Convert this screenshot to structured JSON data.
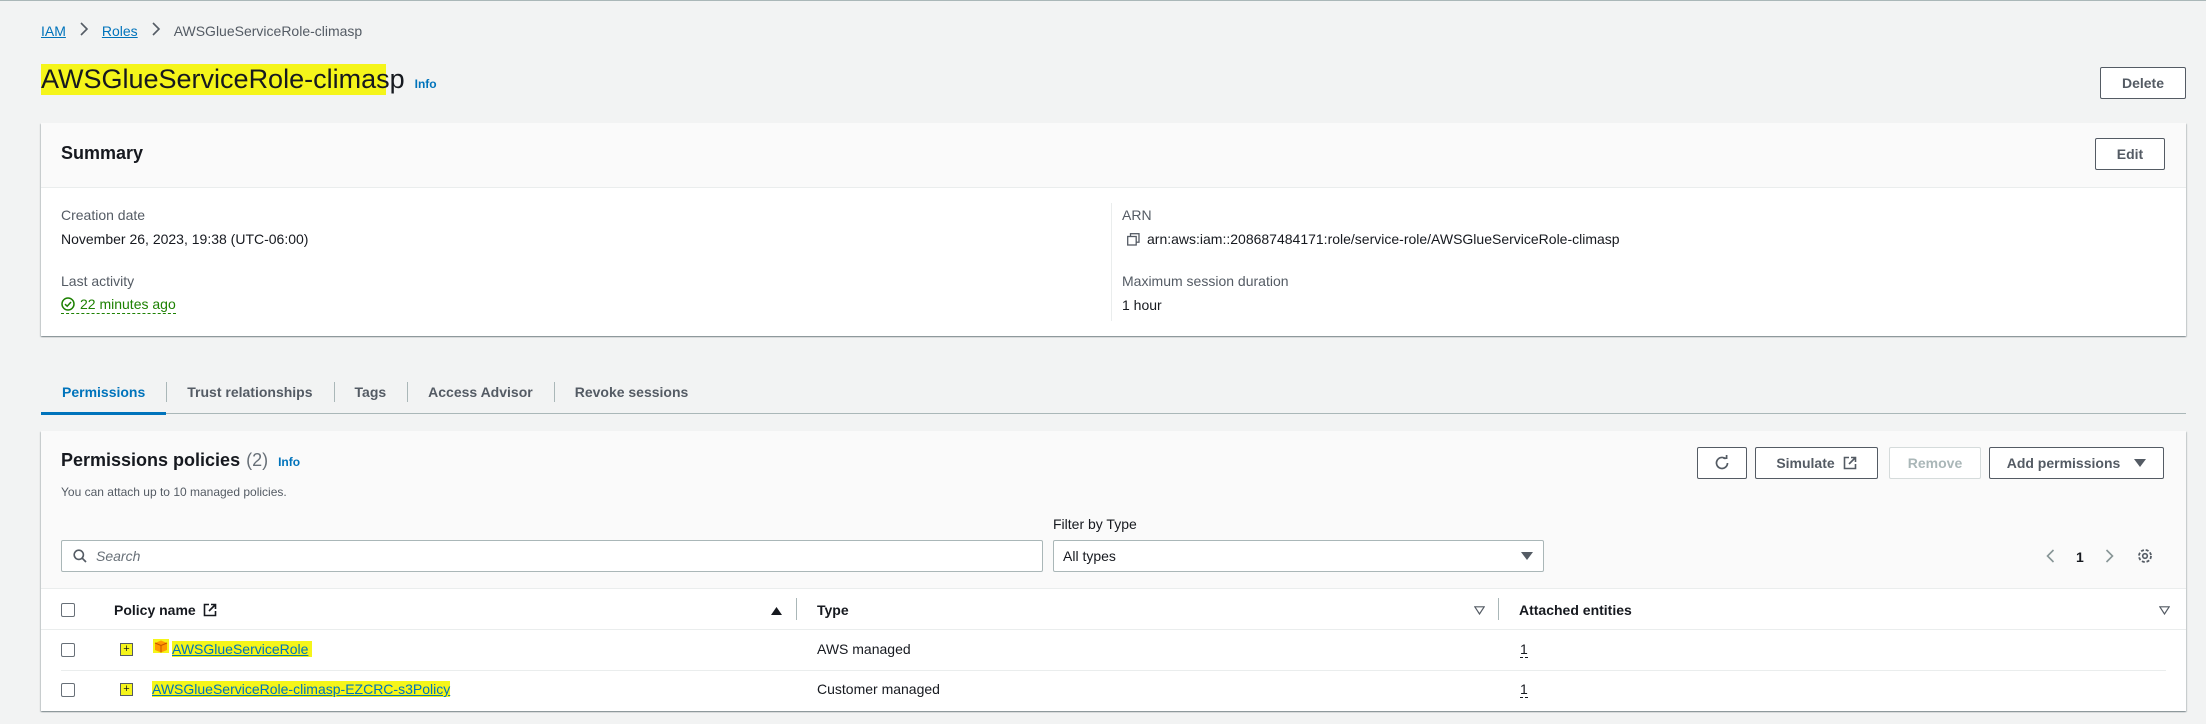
{
  "breadcrumb": {
    "items": [
      "IAM",
      "Roles"
    ],
    "current": "AWSGlueServiceRole-climasp"
  },
  "header": {
    "title": "AWSGlueServiceRole-climasp",
    "info": "Info",
    "delete_label": "Delete"
  },
  "summary": {
    "title": "Summary",
    "edit_label": "Edit",
    "creation_date_label": "Creation date",
    "creation_date": "November 26, 2023, 19:38 (UTC-06:00)",
    "last_activity_label": "Last activity",
    "last_activity": "22 minutes ago",
    "arn_label": "ARN",
    "arn": "arn:aws:iam::208687484171:role/service-role/AWSGlueServiceRole-climasp",
    "max_session_label": "Maximum session duration",
    "max_session": "1 hour"
  },
  "tabs": [
    {
      "label": "Permissions",
      "active": true
    },
    {
      "label": "Trust relationships"
    },
    {
      "label": "Tags"
    },
    {
      "label": "Access Advisor"
    },
    {
      "label": "Revoke sessions"
    }
  ],
  "permissions": {
    "title": "Permissions policies",
    "count": "(2)",
    "info": "Info",
    "subtitle": "You can attach up to 10 managed policies.",
    "simulate_label": "Simulate",
    "remove_label": "Remove",
    "add_permissions_label": "Add permissions",
    "search_placeholder": "Search",
    "filter_label": "Filter by Type",
    "filter_value": "All types",
    "page": "1",
    "columns": {
      "policy_name": "Policy name",
      "type": "Type",
      "attached": "Attached entities"
    },
    "rows": [
      {
        "name": "AWSGlueServiceRole",
        "type": "AWS managed",
        "attached": "1"
      },
      {
        "name": "AWSGlueServiceRole-climasp-EZCRC-s3Policy",
        "type": "Customer managed",
        "attached": "1"
      }
    ]
  },
  "colors": {
    "link": "#0073bb",
    "success": "#1d8102",
    "highlight": "#f5f51a",
    "aws_orange": "#ff9900"
  },
  "icons": [
    "chevron-right-icon",
    "copy-icon",
    "check-circle-icon",
    "refresh-icon",
    "external-link-icon",
    "caret-down-icon",
    "search-icon",
    "chevron-left-icon",
    "gear-icon",
    "sort-up-icon",
    "sort-down-icon",
    "expand-icon",
    "aws-managed-icon"
  ]
}
